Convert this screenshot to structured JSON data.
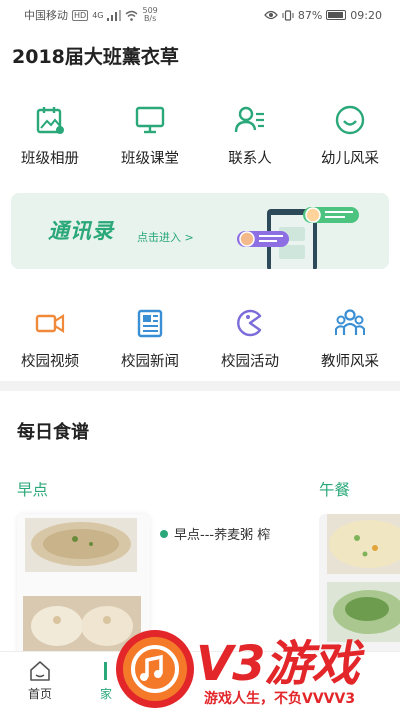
{
  "status_bar": {
    "carrier": "中国移动",
    "hd_badge": "HD",
    "network": "4G",
    "speed_value": "509",
    "speed_unit": "B/s",
    "battery": "87%",
    "time": "09:20"
  },
  "app": {
    "title": "2018届大班薰衣草"
  },
  "grid_top": [
    {
      "label": "班级相册",
      "icon": "album-icon"
    },
    {
      "label": "班级课堂",
      "icon": "classroom-icon"
    },
    {
      "label": "联系人",
      "icon": "contacts-icon"
    },
    {
      "label": "幼儿风采",
      "icon": "smile-icon"
    }
  ],
  "banner": {
    "title": "通讯录",
    "subtitle": "点击进入 >"
  },
  "grid_bottom": [
    {
      "label": "校园视频",
      "icon": "video-icon"
    },
    {
      "label": "校园新闻",
      "icon": "news-icon"
    },
    {
      "label": "校园活动",
      "icon": "activity-icon"
    },
    {
      "label": "教师风采",
      "icon": "teachers-icon"
    }
  ],
  "recipes": {
    "title": "每日食谱",
    "meals": [
      {
        "label": "早点",
        "item": "早点---荞麦粥 榨"
      },
      {
        "label": "午餐"
      }
    ]
  },
  "bottom_nav": [
    {
      "label": "首页"
    },
    {
      "label": "家"
    }
  ],
  "watermark": {
    "brand": "V3游戏",
    "slogan": "游戏人生，不负VVVV3"
  },
  "colors": {
    "accent": "#2aa87a",
    "activity": "#7b6cd9",
    "video": "#f08a3a",
    "news": "#3a8fd4",
    "watermark": "#e2262a"
  }
}
